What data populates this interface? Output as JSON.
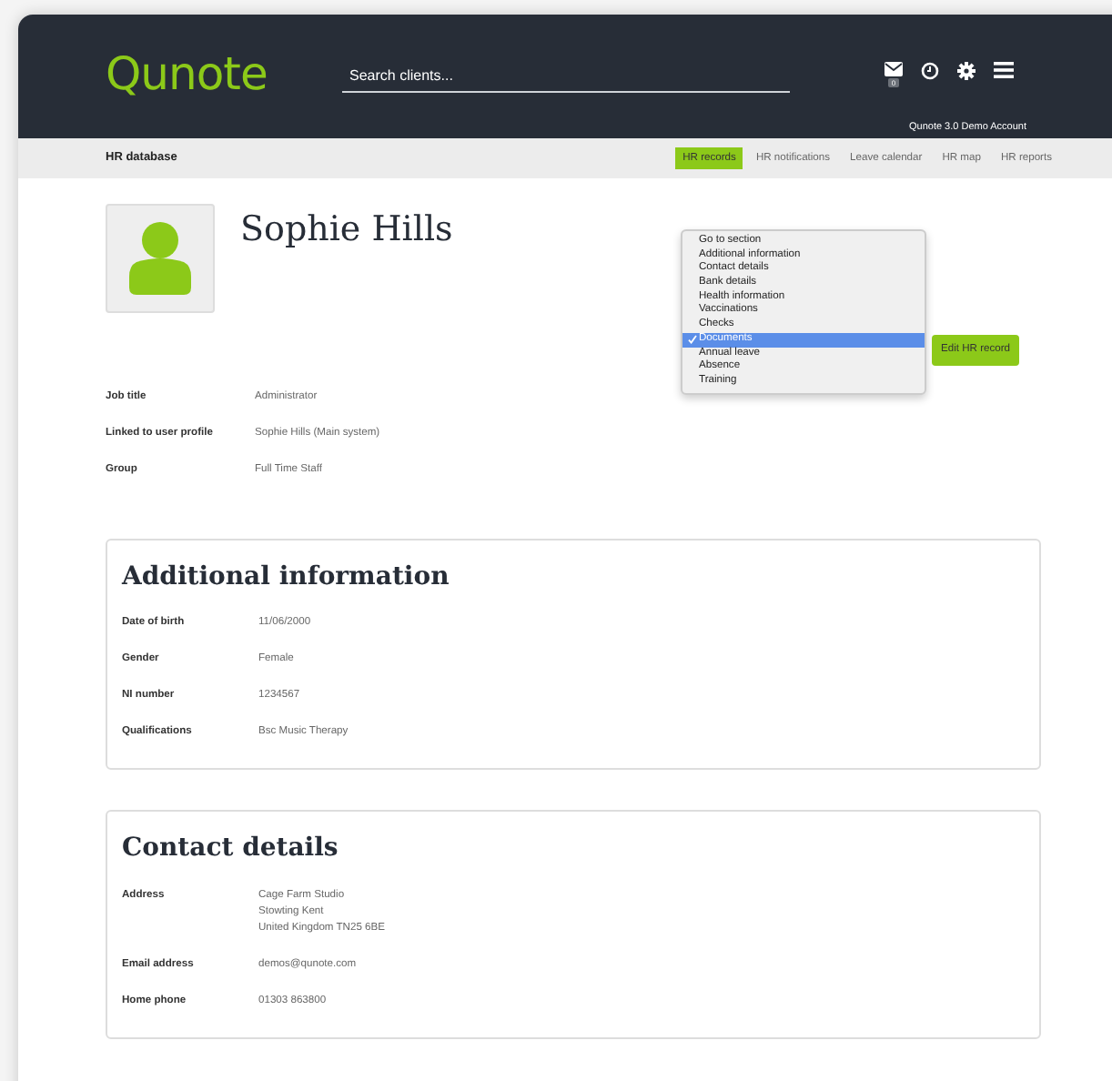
{
  "header": {
    "logo": "Qunote",
    "search": {
      "placeholder": "Search clients..."
    },
    "mail_count": "0",
    "account": "Qunote 3.0 Demo Account"
  },
  "subnav": {
    "title": "HR database",
    "tabs": [
      {
        "label": "HR records",
        "selected": true
      },
      {
        "label": "HR notifications",
        "selected": false
      },
      {
        "label": "Leave calendar",
        "selected": false
      },
      {
        "label": "HR map",
        "selected": false
      },
      {
        "label": "HR reports",
        "selected": false
      }
    ]
  },
  "profile": {
    "name": "Sophie Hills",
    "fields": [
      {
        "label": "Job title",
        "value": "Administrator"
      },
      {
        "label": "Linked to user profile",
        "value": "Sophie Hills (Main system)"
      },
      {
        "label": "Group",
        "value": "Full Time Staff"
      }
    ]
  },
  "section_menu": {
    "options": [
      {
        "label": "Go to section",
        "selected": false
      },
      {
        "label": "Additional information",
        "selected": false
      },
      {
        "label": "Contact details",
        "selected": false
      },
      {
        "label": "Bank details",
        "selected": false
      },
      {
        "label": "Health information",
        "selected": false
      },
      {
        "label": "Vaccinations",
        "selected": false
      },
      {
        "label": "Checks",
        "selected": false
      },
      {
        "label": "Documents",
        "selected": true
      },
      {
        "label": "Annual leave",
        "selected": false
      },
      {
        "label": "Absence",
        "selected": false
      },
      {
        "label": "Training",
        "selected": false
      }
    ]
  },
  "edit_button": "Edit HR record",
  "sections": [
    {
      "title": "Additional information",
      "fields": [
        {
          "label": "Date of birth",
          "lines": [
            "11/06/2000"
          ]
        },
        {
          "label": "Gender",
          "lines": [
            "Female"
          ]
        },
        {
          "label": "NI number",
          "lines": [
            "1234567"
          ]
        },
        {
          "label": "Qualifications",
          "lines": [
            "Bsc Music Therapy"
          ]
        }
      ]
    },
    {
      "title": "Contact details",
      "fields": [
        {
          "label": "Address",
          "lines": [
            "Cage Farm Studio",
            "Stowting Kent",
            "United Kingdom TN25 6BE"
          ]
        },
        {
          "label": "Email address",
          "lines": [
            "demos@qunote.com"
          ]
        },
        {
          "label": "Home phone",
          "lines": [
            "01303 863800"
          ]
        }
      ]
    }
  ]
}
